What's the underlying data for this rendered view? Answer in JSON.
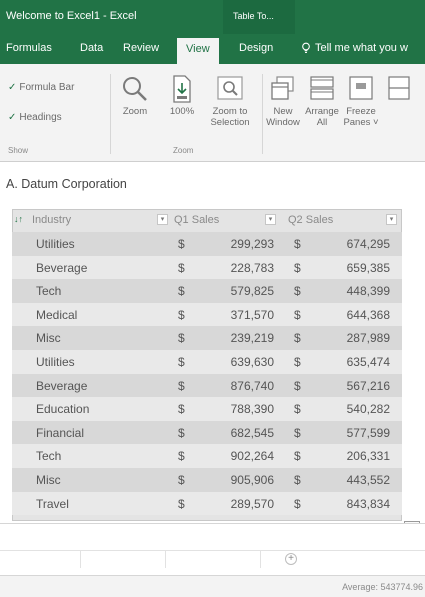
{
  "window": {
    "title": "Welcome to Excel1 - Excel",
    "context_tab": "Table To..."
  },
  "tabs": [
    "Formulas",
    "Data",
    "Review",
    "View",
    "Design"
  ],
  "tell_me": "Tell me what you w",
  "ribbon": {
    "show": {
      "formula_bar": "Formula Bar",
      "headings": "Headings",
      "group_label": "Show"
    },
    "zoom": {
      "zoom": "Zoom",
      "hundred": "100%",
      "zoom_to_selection": [
        "Zoom to",
        "Selection"
      ],
      "group_label": "Zoom"
    },
    "window": {
      "new_window": [
        "New",
        "Window"
      ],
      "arrange_all": [
        "Arrange",
        "All"
      ],
      "freeze_panes": [
        "Freeze",
        "Panes ˅"
      ]
    }
  },
  "name_box": "A. Datum Corporation",
  "table": {
    "headers": [
      "Industry",
      "Q1 Sales",
      "Q2 Sales"
    ],
    "currency": "$",
    "rows": [
      {
        "industry": "Utilities",
        "q1": "299,293",
        "q2": "674,295"
      },
      {
        "industry": "Beverage",
        "q1": "228,783",
        "q2": "659,385"
      },
      {
        "industry": "Tech",
        "q1": "579,825",
        "q2": "448,399"
      },
      {
        "industry": "Medical",
        "q1": "371,570",
        "q2": "644,368"
      },
      {
        "industry": "Misc",
        "q1": "239,219",
        "q2": "287,989"
      },
      {
        "industry": "Utilities",
        "q1": "639,630",
        "q2": "635,474"
      },
      {
        "industry": "Beverage",
        "q1": "876,740",
        "q2": "567,216"
      },
      {
        "industry": "Education",
        "q1": "788,390",
        "q2": "540,282"
      },
      {
        "industry": "Financial",
        "q1": "682,545",
        "q2": "577,599"
      },
      {
        "industry": "Tech",
        "q1": "902,264",
        "q2": "206,331"
      },
      {
        "industry": "Misc",
        "q1": "905,906",
        "q2": "443,552"
      },
      {
        "industry": "Travel",
        "q1": "289,570",
        "q2": "843,834"
      }
    ]
  },
  "status": {
    "average": "Average: 543774.96"
  },
  "colors": {
    "excel_green": "#217346",
    "ribbon_bg": "#f3f3f3"
  }
}
